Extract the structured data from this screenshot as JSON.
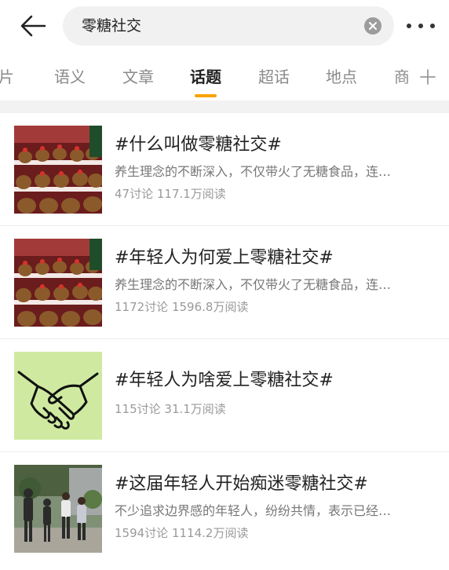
{
  "search": {
    "query": "零糖社交"
  },
  "tabs": [
    {
      "label": "图片"
    },
    {
      "label": "语义"
    },
    {
      "label": "文章"
    },
    {
      "label": "话题"
    },
    {
      "label": "超话"
    },
    {
      "label": "地点"
    },
    {
      "label": "商"
    }
  ],
  "active_tab": "话题",
  "accent_color": "#f7a300",
  "icons": [
    "back-arrow-icon",
    "clear-icon",
    "more-icon",
    "add-icon"
  ],
  "topics": [
    {
      "title": "#什么叫做零糖社交#",
      "desc": "养生理念的不断深入，不仅带火了无糖食品，连…",
      "discussions": "47讨论",
      "reads": "117.1万阅读",
      "image": "plush capybara display"
    },
    {
      "title": "#年轻人为何爱上零糖社交#",
      "desc": "养生理念的不断深入，不仅带火了无糖食品，连…",
      "discussions": "1172讨论",
      "reads": "1596.8万阅读",
      "image": "plush capybara display"
    },
    {
      "title": "#年轻人为啥爱上零糖社交#",
      "desc": "",
      "discussions": "115讨论",
      "reads": "31.1万阅读",
      "image": "handshake icon on green"
    },
    {
      "title": "#这届年轻人开始痴迷零糖社交#",
      "desc": "不少追求边界感的年轻人，纷纷共情，表示已经…",
      "discussions": "1594讨论",
      "reads": "1114.2万阅读",
      "image": "people walking in garden"
    }
  ]
}
